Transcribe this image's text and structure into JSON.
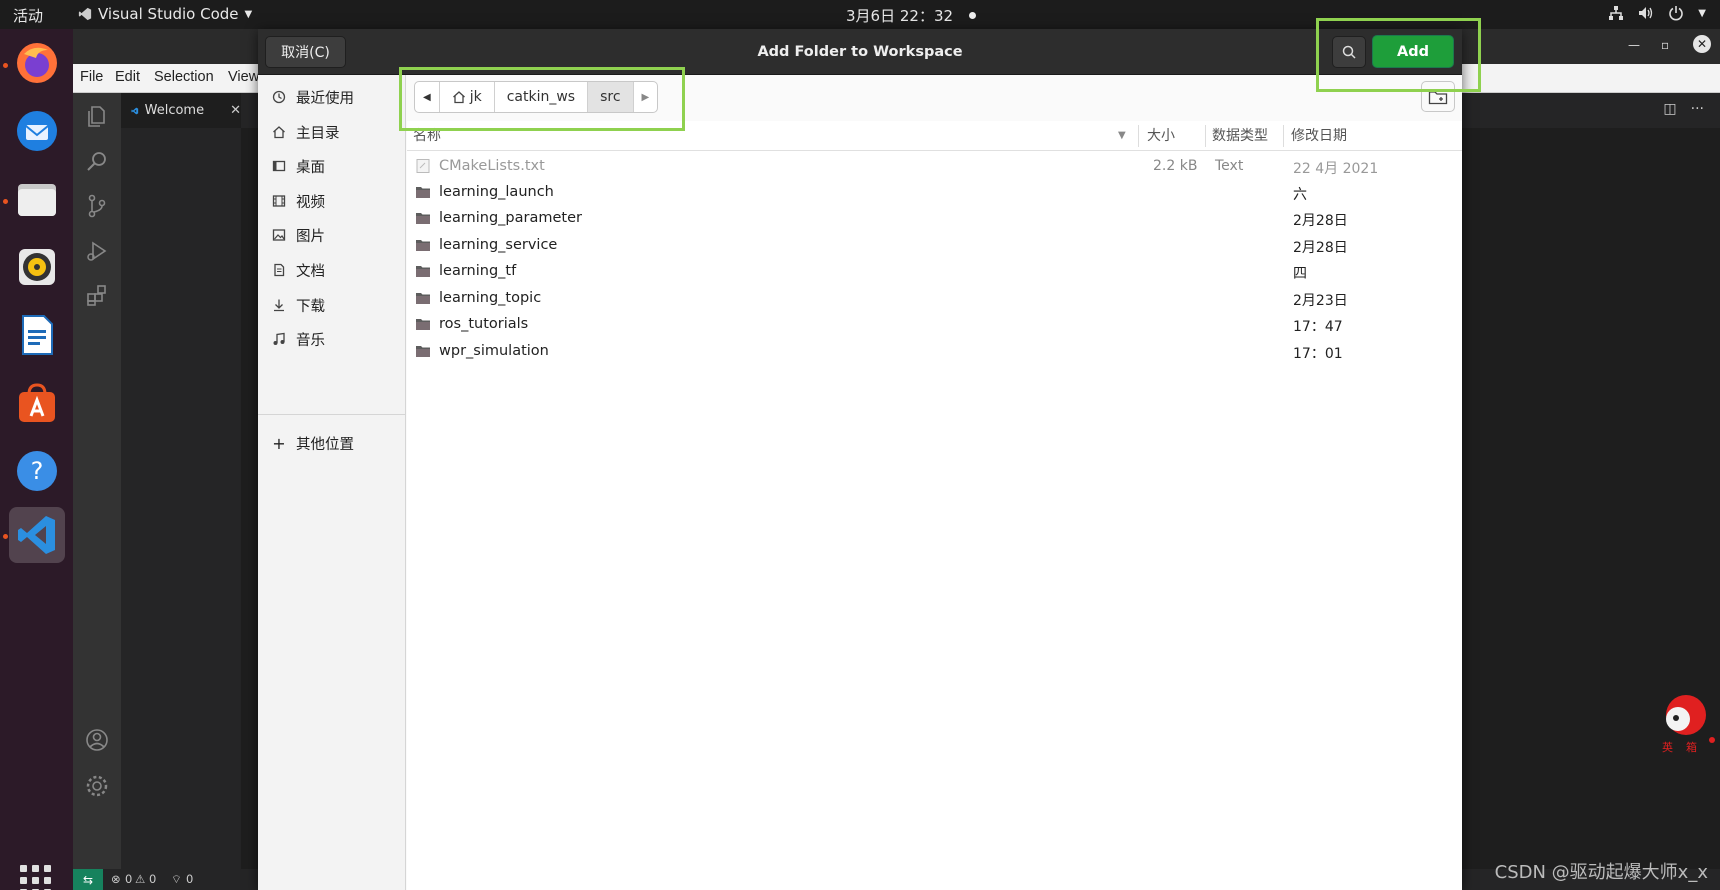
{
  "topbar": {
    "activities": "活动",
    "app_name": "Visual Studio Code",
    "clock": "3月6日 22：32"
  },
  "dock": {
    "apps": [
      "firefox-icon",
      "thunderbird-icon",
      "files-icon",
      "rhythmbox-icon",
      "writer-icon",
      "software-icon",
      "help-icon",
      "vscode-icon"
    ]
  },
  "vscode": {
    "menu": [
      "File",
      "Edit",
      "Selection",
      "View"
    ],
    "tab_label": "Welcome",
    "status": {
      "errors": "0",
      "warnings": "0",
      "ports": "0"
    }
  },
  "dialog": {
    "title": "Add Folder to Workspace",
    "cancel_label": "取消(C)",
    "add_label": "Add",
    "places": [
      {
        "label": "最近使用",
        "icon": "clock-icon"
      },
      {
        "label": "主目录",
        "icon": "home-icon"
      },
      {
        "label": "桌面",
        "icon": "desktop-icon"
      },
      {
        "label": "视频",
        "icon": "video-icon"
      },
      {
        "label": "图片",
        "icon": "image-icon"
      },
      {
        "label": "文档",
        "icon": "document-icon"
      },
      {
        "label": "下载",
        "icon": "download-icon"
      },
      {
        "label": "音乐",
        "icon": "music-icon"
      }
    ],
    "other_locations": "其他位置",
    "path": [
      "jk",
      "catkin_ws",
      "src"
    ],
    "columns": {
      "name": "名称",
      "size": "大小",
      "type": "数据类型",
      "modified": "修改日期"
    },
    "files": [
      {
        "name": "CMakeLists.txt",
        "size": "2.2 kB",
        "type": "Text",
        "modified": "22 4月 2021",
        "kind": "file"
      },
      {
        "name": "learning_launch",
        "size": "",
        "type": "",
        "modified": "六",
        "kind": "folder"
      },
      {
        "name": "learning_parameter",
        "size": "",
        "type": "",
        "modified": "2月28日",
        "kind": "folder"
      },
      {
        "name": "learning_service",
        "size": "",
        "type": "",
        "modified": "2月28日",
        "kind": "folder"
      },
      {
        "name": "learning_tf",
        "size": "",
        "type": "",
        "modified": "四",
        "kind": "folder"
      },
      {
        "name": "learning_topic",
        "size": "",
        "type": "",
        "modified": "2月23日",
        "kind": "folder"
      },
      {
        "name": "ros_tutorials",
        "size": "",
        "type": "",
        "modified": "17：47",
        "kind": "folder"
      },
      {
        "name": "wpr_simulation",
        "size": "",
        "type": "",
        "modified": "17：01",
        "kind": "folder"
      }
    ]
  },
  "watermark": "CSDN @驱动起爆大师x_x",
  "colors": {
    "add_button": "#1e9e3a",
    "highlight_box": "#8fd14f",
    "dock_bg": "#2c1a28",
    "running_dot": "#e95420"
  }
}
